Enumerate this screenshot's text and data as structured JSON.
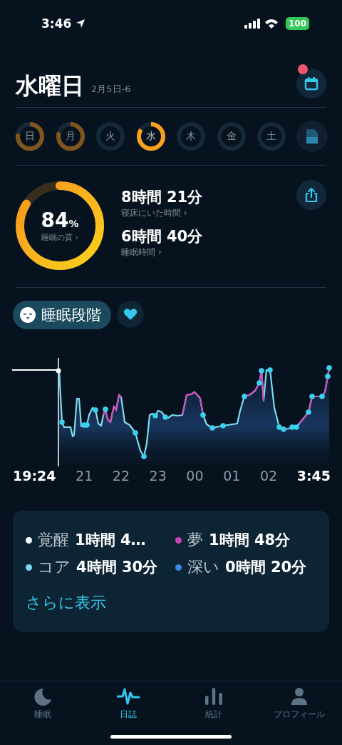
{
  "status_bar": {
    "time": "3:46",
    "battery": "100"
  },
  "header": {
    "title": "水曜日",
    "date_range": "2月5日-6",
    "notification": true
  },
  "days": [
    {
      "label": "日",
      "level": 0.78,
      "selected": false
    },
    {
      "label": "月",
      "level": 0.8,
      "selected": false
    },
    {
      "label": "火",
      "level": 0,
      "selected": false
    },
    {
      "label": "水",
      "level": 0.84,
      "selected": true
    },
    {
      "label": "木",
      "level": 0,
      "selected": false
    },
    {
      "label": "金",
      "level": 0,
      "selected": false
    },
    {
      "label": "土",
      "level": 0,
      "selected": false
    }
  ],
  "summary": {
    "quality": {
      "value": "84",
      "unit": "%",
      "label": "睡眠の質 ›",
      "level": 0.84
    },
    "stats": [
      {
        "value": "8時間 21分",
        "label": "寝床にいた時間 ›"
      },
      {
        "value": "6時間 40分",
        "label": "睡眠時間 ›"
      }
    ]
  },
  "stage_chip": "睡眠段階",
  "chart": {
    "x_labels": [
      {
        "text": "19:24",
        "bold": true
      },
      {
        "text": "21",
        "bold": false
      },
      {
        "text": "22",
        "bold": false
      },
      {
        "text": "23",
        "bold": false
      },
      {
        "text": "00",
        "bold": false
      },
      {
        "text": "01",
        "bold": false
      },
      {
        "text": "02",
        "bold": false
      },
      {
        "text": "3:45",
        "bold": true
      }
    ]
  },
  "legend": {
    "items": [
      {
        "name": "覚醒",
        "duration": "1時間 4…",
        "color": "#ffffff"
      },
      {
        "name": "夢",
        "duration": "1時間 48分",
        "color": "#c945b4"
      },
      {
        "name": "コア",
        "duration": "4時間 30分",
        "color": "#7fd6f2"
      },
      {
        "name": "深い",
        "duration": "0時間 20分",
        "color": "#3d86e8"
      }
    ],
    "more_link": "さらに表示"
  },
  "tab_bar": [
    {
      "label": "睡眠",
      "selected": false
    },
    {
      "label": "日誌",
      "selected": true
    },
    {
      "label": "統計",
      "selected": false
    },
    {
      "label": "プロフィール",
      "selected": false
    }
  ]
}
